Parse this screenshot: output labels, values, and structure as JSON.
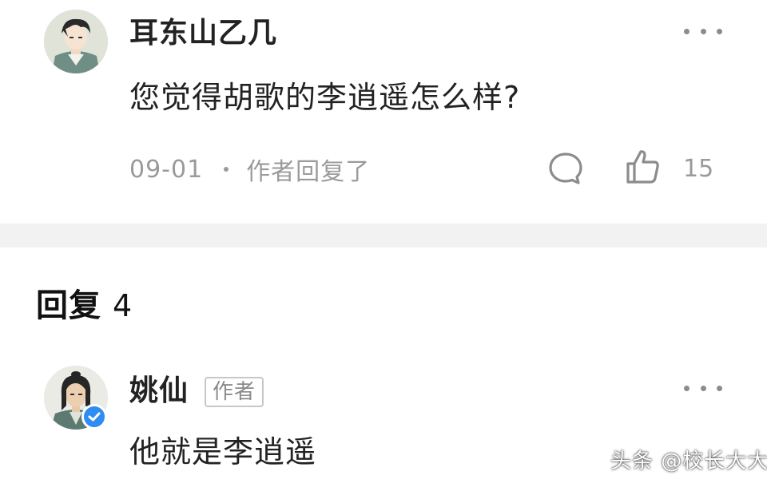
{
  "top_comment": {
    "username": "耳东山乙几",
    "avatar_icon": "avatar-cartoon-boy",
    "text": "您觉得胡歌的李逍遥怎么样?",
    "date": "09-01",
    "author_replied": "作者回复了",
    "reply_icon": "comment-bubble-icon",
    "like_icon": "thumbs-up-icon",
    "like_count": "15",
    "more_icon": "more-dots-icon"
  },
  "replies": {
    "title": "回复",
    "count": "4"
  },
  "reply_comment": {
    "username": "姚仙",
    "author_badge": "作者",
    "avatar_icon": "avatar-swordsman",
    "verified_icon": "verified-check-icon",
    "text": "他就是李逍遥",
    "more_icon": "more-dots-icon"
  },
  "watermark": "头条 @校长大大",
  "colors": {
    "text_primary": "#222222",
    "text_secondary": "#9a9a9a",
    "divider": "#f2f2f2",
    "verified": "#2f8cf3"
  }
}
